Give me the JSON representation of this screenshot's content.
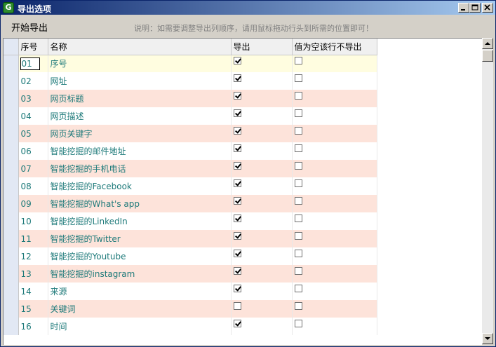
{
  "window": {
    "title": "导出选项"
  },
  "toolbar": {
    "start_label": "开始导出",
    "hint": "说明：如需要调整导出列顺序，请用鼠标拖动行头到所需的位置即可！"
  },
  "grid": {
    "columns": [
      "序号",
      "名称",
      "导出",
      "值为空该行不导出"
    ],
    "rows": [
      {
        "id": "01",
        "name": "序号",
        "export": true,
        "skip_empty": false
      },
      {
        "id": "02",
        "name": "网址",
        "export": true,
        "skip_empty": false
      },
      {
        "id": "03",
        "name": "网页标题",
        "export": true,
        "skip_empty": false
      },
      {
        "id": "04",
        "name": "网页描述",
        "export": true,
        "skip_empty": false
      },
      {
        "id": "05",
        "name": "网页关键字",
        "export": true,
        "skip_empty": false
      },
      {
        "id": "06",
        "name": "智能挖掘的邮件地址",
        "export": true,
        "skip_empty": false
      },
      {
        "id": "07",
        "name": "智能挖掘的手机电话",
        "export": true,
        "skip_empty": false
      },
      {
        "id": "08",
        "name": "智能挖掘的Facebook",
        "export": true,
        "skip_empty": false
      },
      {
        "id": "09",
        "name": "智能挖掘的What's app",
        "export": true,
        "skip_empty": false
      },
      {
        "id": "10",
        "name": "智能挖掘的LinkedIn",
        "export": true,
        "skip_empty": false
      },
      {
        "id": "11",
        "name": "智能挖掘的Twitter",
        "export": true,
        "skip_empty": false
      },
      {
        "id": "12",
        "name": "智能挖掘的Youtube",
        "export": true,
        "skip_empty": false
      },
      {
        "id": "13",
        "name": "智能挖掘的instagram",
        "export": true,
        "skip_empty": false
      },
      {
        "id": "14",
        "name": "来源",
        "export": true,
        "skip_empty": false
      },
      {
        "id": "15",
        "name": "关键词",
        "export": false,
        "skip_empty": false
      },
      {
        "id": "16",
        "name": "时间",
        "export": true,
        "skip_empty": false
      }
    ]
  }
}
